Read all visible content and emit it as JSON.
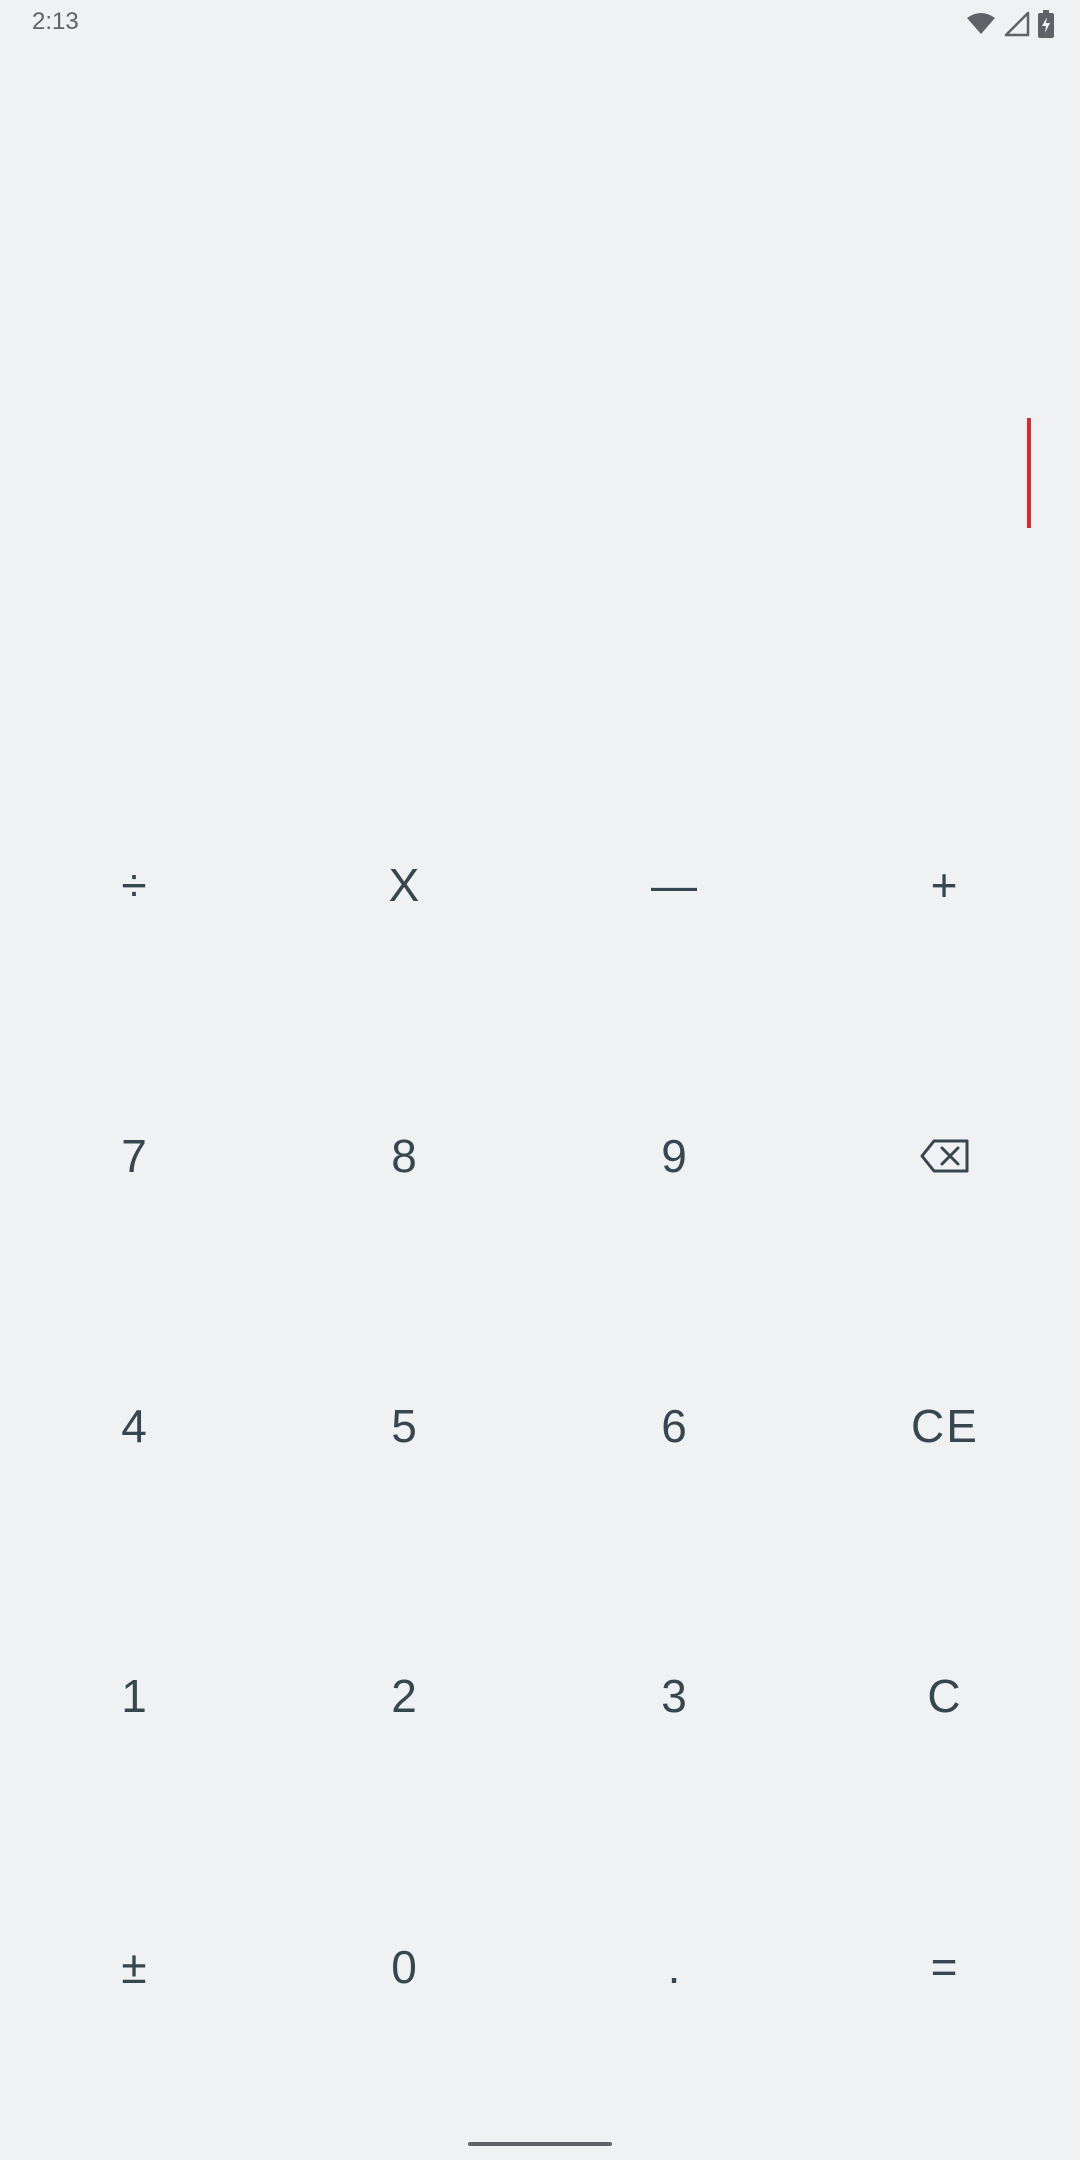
{
  "status_bar": {
    "time": "2:13",
    "icons": [
      "wifi-icon",
      "cell-signal-icon",
      "battery-charging-icon"
    ]
  },
  "display": {
    "expression": "",
    "cursor_color": "#d32f2f"
  },
  "keypad": {
    "operators": {
      "divide": "÷",
      "multiply": "X",
      "subtract": "—",
      "add": "+"
    },
    "digits": {
      "seven": "7",
      "eight": "8",
      "nine": "9",
      "four": "4",
      "five": "5",
      "six": "6",
      "one": "1",
      "two": "2",
      "three": "3",
      "zero": "0"
    },
    "functions": {
      "backspace_icon": "backspace-icon",
      "clear_entry": "CE",
      "clear": "C",
      "plus_minus": "±",
      "decimal": ".",
      "equals": "="
    }
  },
  "theme": {
    "background": "#eff1f3",
    "key_text": "#37474f"
  }
}
